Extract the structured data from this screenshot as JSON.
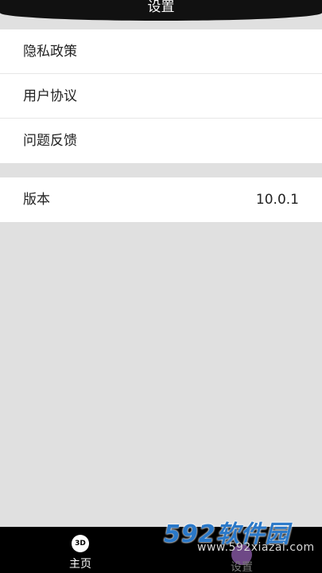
{
  "header": {
    "title": "设置"
  },
  "settings_group": {
    "items": [
      {
        "label": "隐私政策"
      },
      {
        "label": "用户协议"
      },
      {
        "label": "问题反馈"
      }
    ]
  },
  "version_row": {
    "label": "版本",
    "value": "10.0.1"
  },
  "tabbar": {
    "home": {
      "label": "主页",
      "icon_text": "3D",
      "icon": "3d-cube-icon"
    },
    "settings": {
      "label": "设置",
      "icon": "settings-icon"
    }
  },
  "watermark": {
    "main": "592软件园",
    "sub": "www.592xiazai.com"
  },
  "colors": {
    "header_bg": "#111111",
    "page_bg": "#e0e0e0",
    "tabbar_bg": "#000000",
    "watermark_blue": "#2a78c8"
  }
}
